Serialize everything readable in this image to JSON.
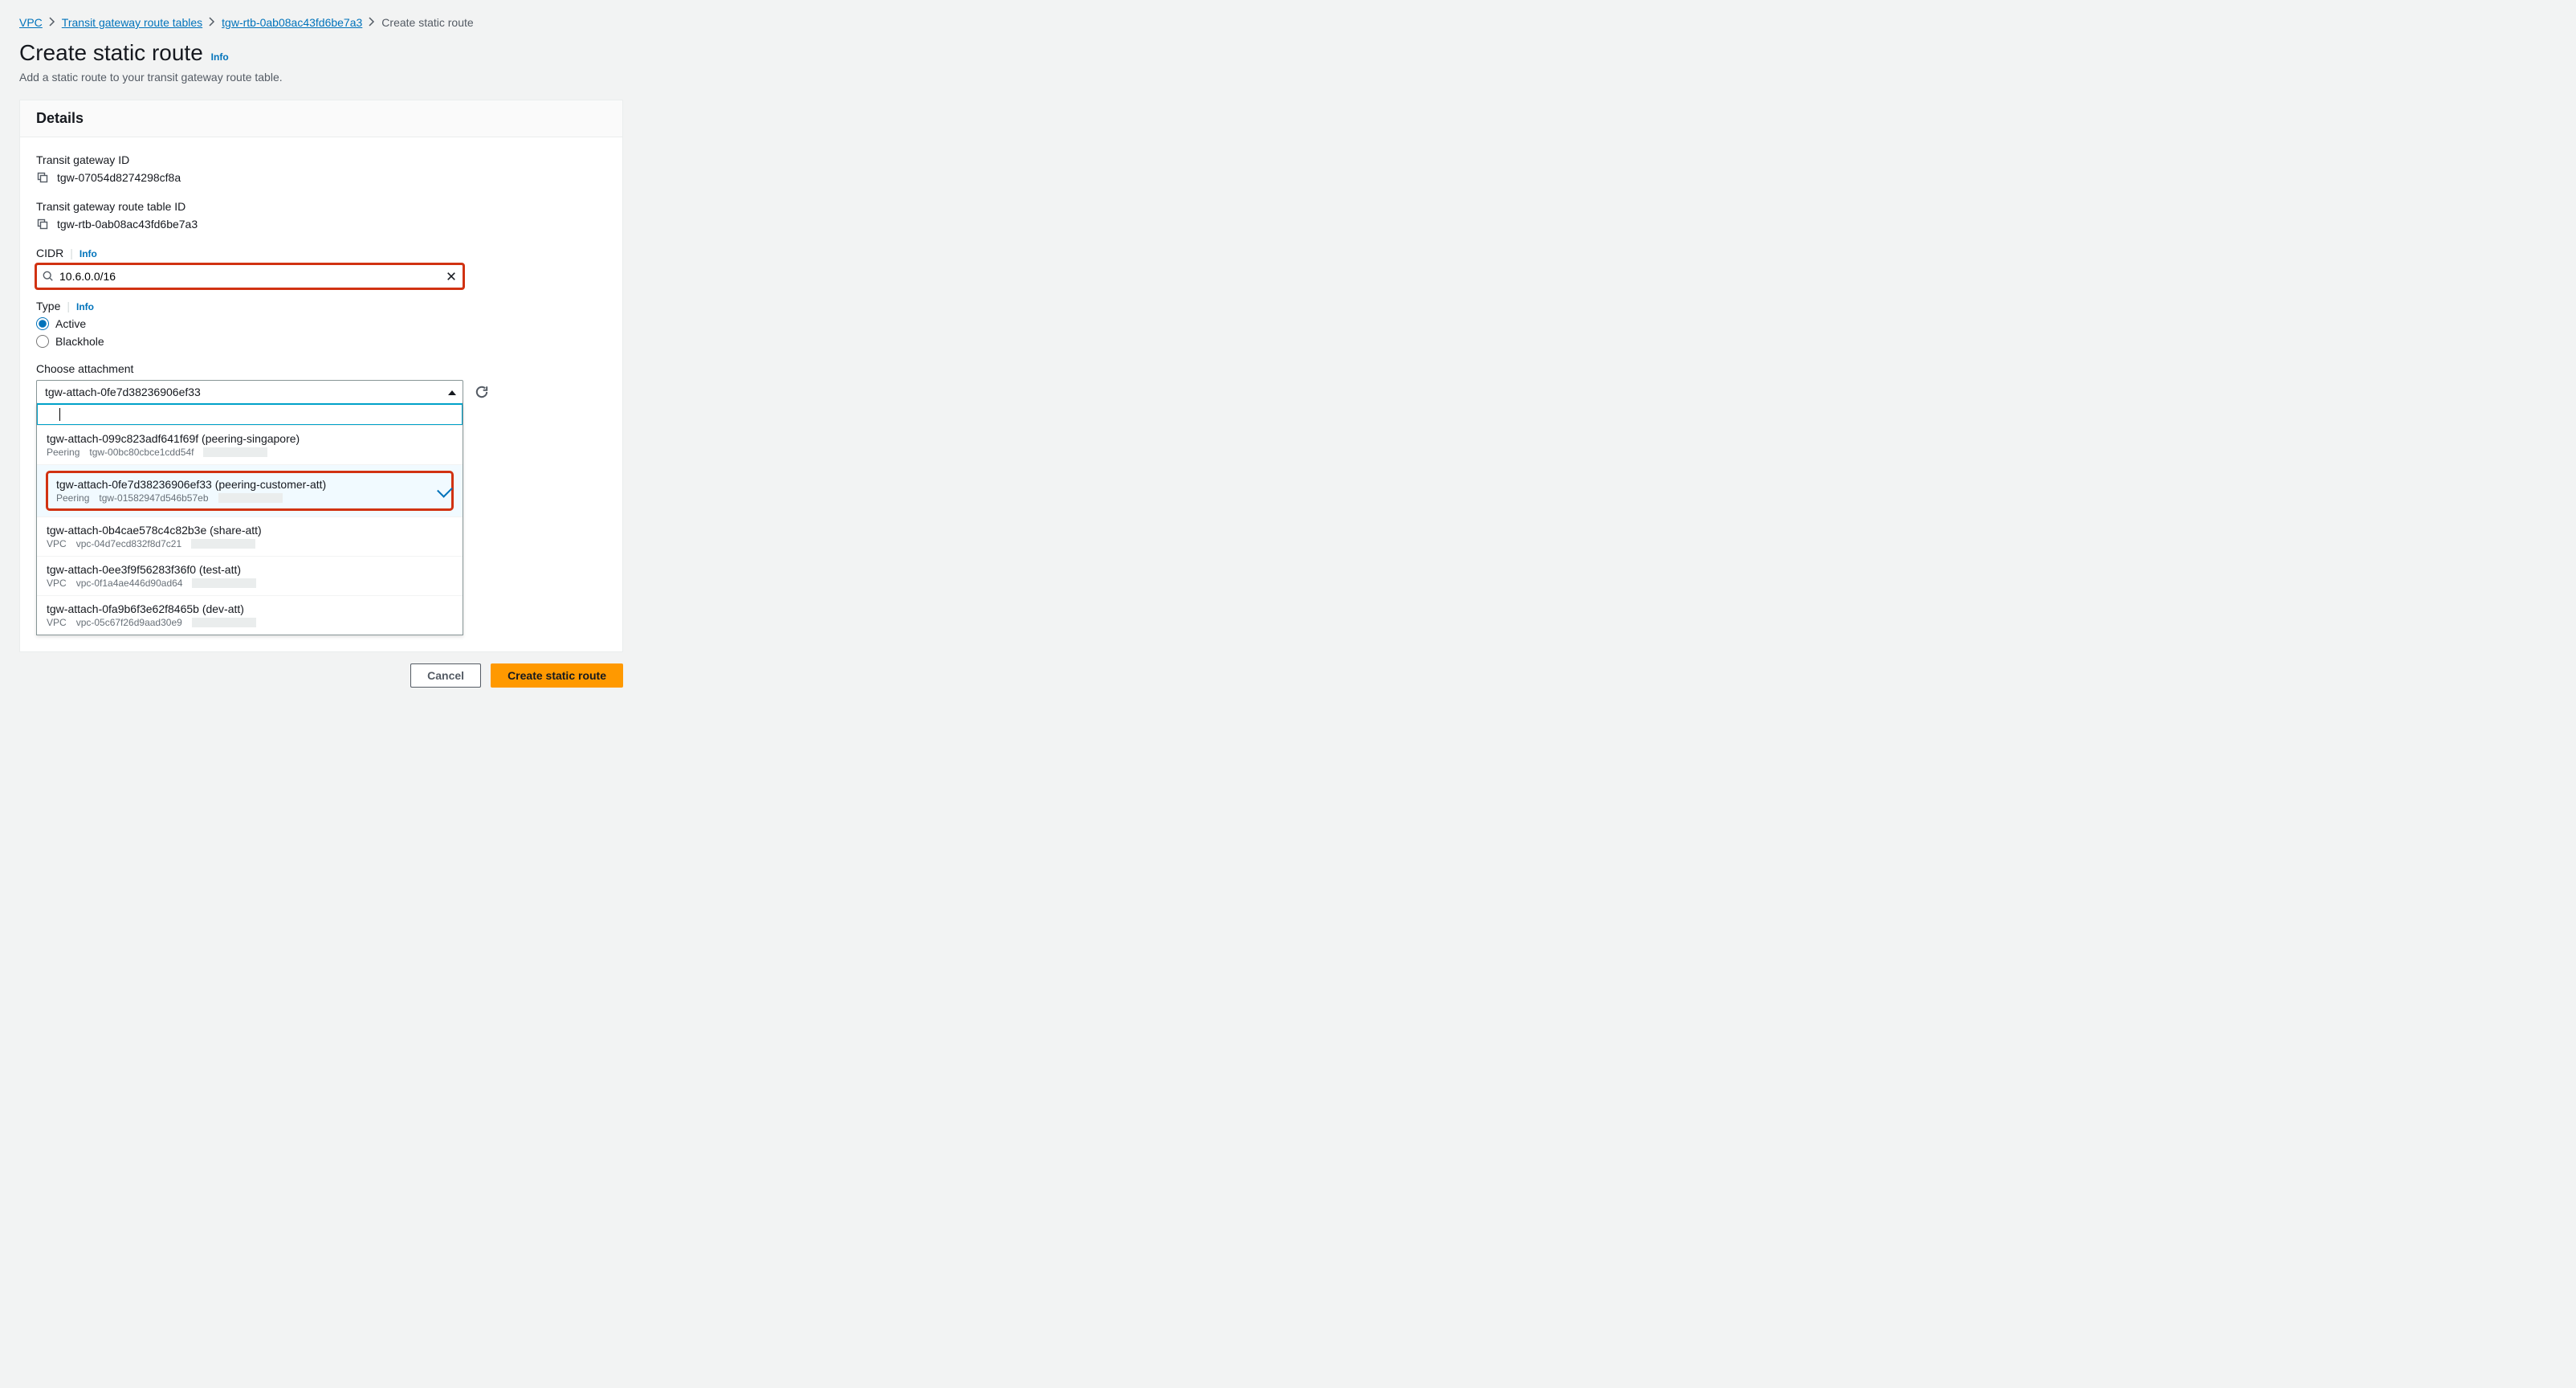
{
  "breadcrumbs": {
    "items": [
      {
        "label": "VPC",
        "link": true
      },
      {
        "label": "Transit gateway route tables",
        "link": true
      },
      {
        "label": "tgw-rtb-0ab08ac43fd6be7a3",
        "link": true
      },
      {
        "label": "Create static route",
        "link": false
      }
    ]
  },
  "page": {
    "title": "Create static route",
    "title_info": "Info",
    "subtitle": "Add a static route to your transit gateway route table."
  },
  "details": {
    "panel_title": "Details",
    "tgw_id_label": "Transit gateway ID",
    "tgw_id_value": "tgw-07054d8274298cf8a",
    "rtb_id_label": "Transit gateway route table ID",
    "rtb_id_value": "tgw-rtb-0ab08ac43fd6be7a3",
    "cidr_label": "CIDR",
    "cidr_info": "Info",
    "cidr_value": "10.6.0.0/16",
    "type_label": "Type",
    "type_info": "Info",
    "type_options": {
      "active": "Active",
      "blackhole": "Blackhole"
    },
    "type_selected": "active",
    "attachment_label": "Choose attachment",
    "attachment_selected": "tgw-attach-0fe7d38236906ef33",
    "attachment_search": "",
    "attachment_options": [
      {
        "title": "tgw-attach-099c823adf641f69f (peering-singapore)",
        "kind": "Peering",
        "resource": "tgw-00bc80cbce1cdd54f",
        "selected": false
      },
      {
        "title": "tgw-attach-0fe7d38236906ef33 (peering-customer-att)",
        "kind": "Peering",
        "resource": "tgw-01582947d546b57eb",
        "selected": true,
        "highlight": true
      },
      {
        "title": "tgw-attach-0b4cae578c4c82b3e (share-att)",
        "kind": "VPC",
        "resource": "vpc-04d7ecd832f8d7c21",
        "selected": false
      },
      {
        "title": "tgw-attach-0ee3f9f56283f36f0 (test-att)",
        "kind": "VPC",
        "resource": "vpc-0f1a4ae446d90ad64",
        "selected": false
      },
      {
        "title": "tgw-attach-0fa9b6f3e62f8465b (dev-att)",
        "kind": "VPC",
        "resource": "vpc-05c67f26d9aad30e9",
        "selected": false
      }
    ]
  },
  "actions": {
    "cancel": "Cancel",
    "submit": "Create static route"
  }
}
